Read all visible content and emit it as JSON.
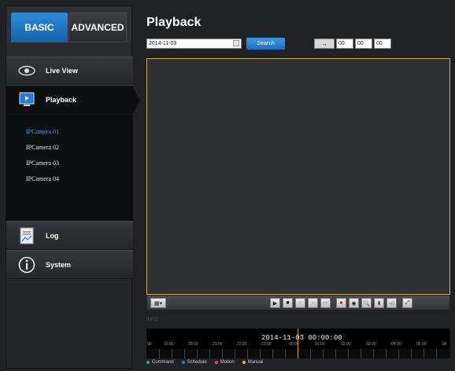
{
  "tabs": {
    "basic": "BASIC",
    "advanced": "ADVANCED"
  },
  "nav": {
    "live_view": "Live View",
    "playback": "Playback",
    "cameras": [
      "IPCamera 01",
      "IPCamera 02",
      "IPCamera 03",
      "IPCamera 04"
    ],
    "log": "Log",
    "system": "System"
  },
  "main": {
    "title": "Playback",
    "date_value": "2014-11-03",
    "search_label": "Search",
    "jump_arrow": "→",
    "hour": "00",
    "minute": "00",
    "second": "00"
  },
  "controls": {
    "layout": "▦▾",
    "play": "▶",
    "stop": "■",
    "slow": "«",
    "fast": "»",
    "step": "⏭",
    "record": "●",
    "snapshot": "◉",
    "zoom": "🔍",
    "download": "⬇",
    "volume": "◀)",
    "fullscreen": "⤢"
  },
  "timeline": {
    "label": "INFO",
    "datetime": "2014-11-03 00:00:00",
    "ticks": [
      "00",
      "19:00",
      "20:00",
      "21:00",
      "22:00",
      "23:00",
      "00:00",
      "01:00",
      "02:00",
      "03:00",
      "04:00",
      "05:00",
      "06"
    ]
  },
  "legend": [
    {
      "label": "Command",
      "color": "#2bb673"
    },
    {
      "label": "Schedule",
      "color": "#3a7bd5"
    },
    {
      "label": "Motion",
      "color": "#e0447a"
    },
    {
      "label": "Manual",
      "color": "#e6c229"
    }
  ]
}
